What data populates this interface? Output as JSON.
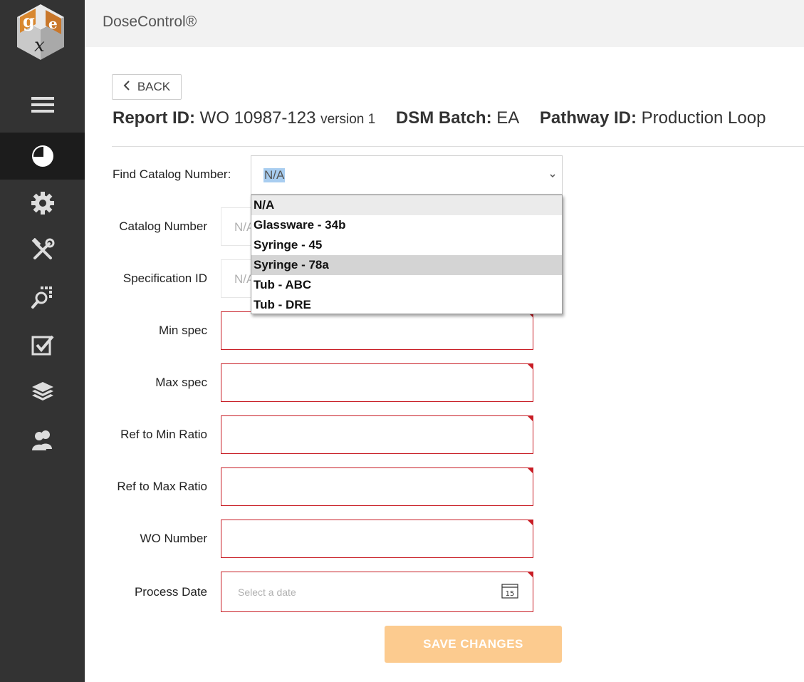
{
  "app": {
    "title": "DoseControl®"
  },
  "sidebar": {
    "items": [
      {
        "icon": "menu-icon"
      },
      {
        "icon": "pie-chart-icon",
        "active": true
      },
      {
        "icon": "gear-icon"
      },
      {
        "icon": "tools-icon"
      },
      {
        "icon": "search-grid-icon"
      },
      {
        "icon": "checkbox-icon"
      },
      {
        "icon": "layers-icon"
      },
      {
        "icon": "users-icon"
      }
    ]
  },
  "back_label": "BACK",
  "header": {
    "report_id_label": "Report ID:",
    "report_id_value": "WO 10987-123",
    "version": "version 1",
    "dsm_batch_label": "DSM Batch:",
    "dsm_batch_value": "EA",
    "pathway_label": "Pathway ID:",
    "pathway_value": "Production Loop"
  },
  "find_catalog": {
    "label": "Find Catalog Number:",
    "selected": "N/A",
    "options": [
      "N/A",
      "Glassware - 34b",
      "Syringe - 45",
      "Syringe - 78a",
      "Tub - ABC",
      "Tub - DRE"
    ],
    "highlighted": "Syringe - 78a"
  },
  "fields": {
    "catalog_number": {
      "label": "Catalog Number",
      "value": "N/A"
    },
    "specification_id": {
      "label": "Specification ID",
      "value": "N/A"
    },
    "min_spec": {
      "label": "Min spec",
      "value": ""
    },
    "max_spec": {
      "label": "Max spec",
      "value": ""
    },
    "ref_min_ratio": {
      "label": "Ref to Min Ratio",
      "value": ""
    },
    "ref_max_ratio": {
      "label": "Ref to Max Ratio",
      "value": ""
    },
    "wo_number": {
      "label": "WO Number",
      "value": ""
    },
    "process_date": {
      "label": "Process Date",
      "placeholder": "Select a date",
      "calendar_day": "15"
    }
  },
  "save_label": "SAVE CHANGES",
  "colors": {
    "sidebar": "#333333",
    "required_border": "#c81d25",
    "save_button": "#fccb8f"
  }
}
